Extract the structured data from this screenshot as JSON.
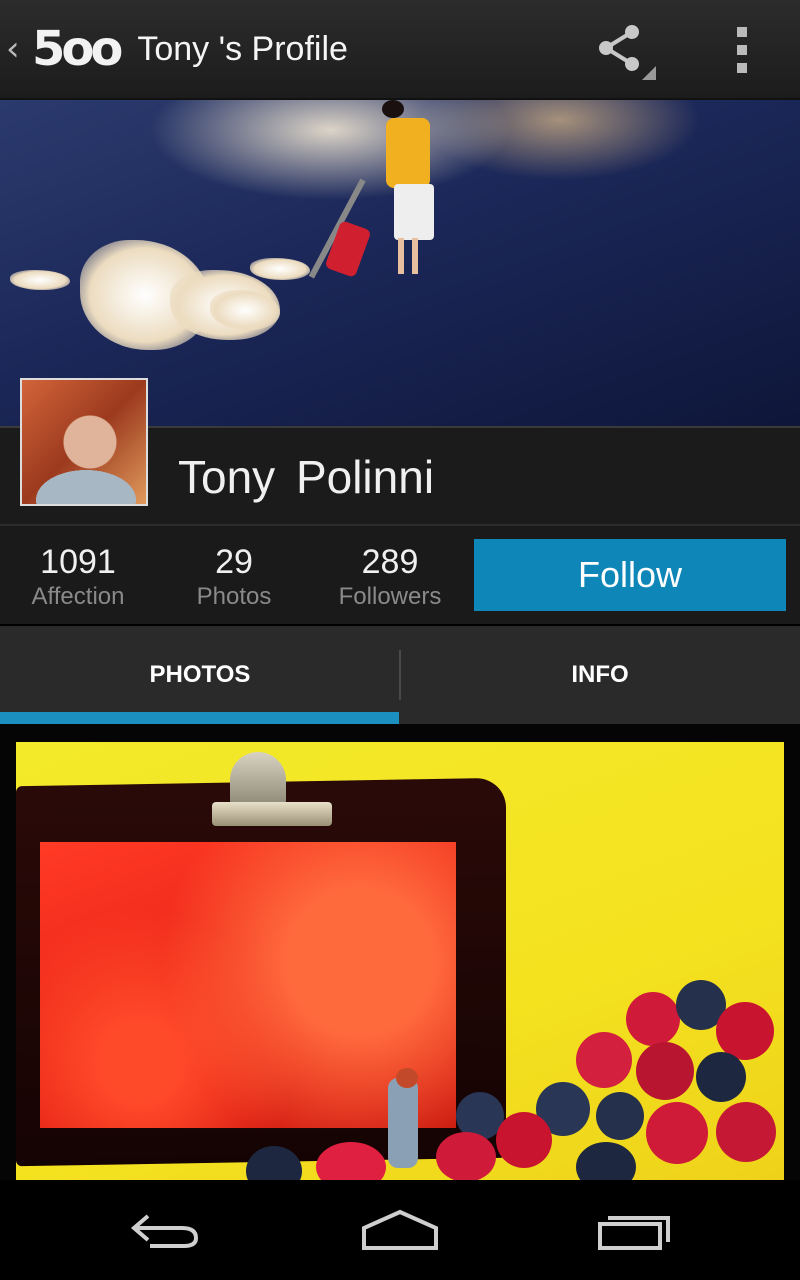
{
  "action_bar": {
    "up_caret": "‹",
    "logo_text": "5oo",
    "title": "Tony 's Profile",
    "share_icon": "share-icon",
    "overflow_icon": "overflow-menu-icon"
  },
  "profile": {
    "name": "Tony  Polinni",
    "avatar": "avatar-photo"
  },
  "stats": [
    {
      "value": "1091",
      "label": "Affection"
    },
    {
      "value": "29",
      "label": "Photos"
    },
    {
      "value": "289",
      "label": "Followers"
    }
  ],
  "follow_button": "Follow",
  "tabs": [
    {
      "label": "PHOTOS",
      "active": true
    },
    {
      "label": "INFO",
      "active": false
    }
  ],
  "colors": {
    "accent": "#0e86b8",
    "tab_indicator": "#1a8fc0",
    "bar_bg": "#1c1c1c"
  },
  "nav_bar": {
    "back_icon": "back-icon",
    "home_icon": "home-icon",
    "recents_icon": "recent-apps-icon"
  }
}
